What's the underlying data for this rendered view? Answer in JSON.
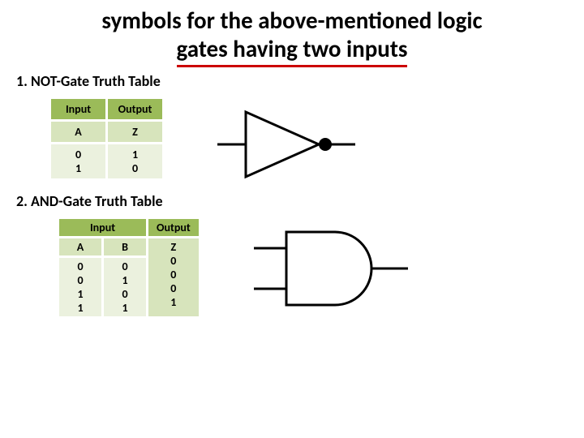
{
  "title_line1": "symbols for the above-mentioned logic",
  "title_line2": "gates having two inputs",
  "sections": {
    "not": {
      "heading": "1. NOT-Gate Truth Table",
      "headers": {
        "input": "Input",
        "output": "Output"
      },
      "subheaders": {
        "a": "A",
        "z": "Z"
      },
      "rows": {
        "a0": "0",
        "a1": "1",
        "z0": "1",
        "z1": "0"
      }
    },
    "and": {
      "heading": "2. AND-Gate Truth Table",
      "headers": {
        "input": "Input",
        "output": "Output"
      },
      "subheaders": {
        "a": "A",
        "b": "B",
        "z": "Z"
      },
      "rows": {
        "a0": "0",
        "b0": "0",
        "a1": "0",
        "b1": "1",
        "a2": "1",
        "b2": "0",
        "a3": "1",
        "b3": "1",
        "z0": "0",
        "z1": "0",
        "z2": "0",
        "z3": "1"
      }
    }
  },
  "chart_data": [
    {
      "type": "table",
      "title": "NOT-Gate Truth Table",
      "columns": [
        "A",
        "Z"
      ],
      "rows": [
        {
          "A": 0,
          "Z": 1
        },
        {
          "A": 1,
          "Z": 0
        }
      ]
    },
    {
      "type": "table",
      "title": "AND-Gate Truth Table",
      "columns": [
        "A",
        "B",
        "Z"
      ],
      "rows": [
        {
          "A": 0,
          "B": 0,
          "Z": 0
        },
        {
          "A": 0,
          "B": 1,
          "Z": 0
        },
        {
          "A": 1,
          "B": 0,
          "Z": 0
        },
        {
          "A": 1,
          "B": 1,
          "Z": 1
        }
      ]
    }
  ]
}
